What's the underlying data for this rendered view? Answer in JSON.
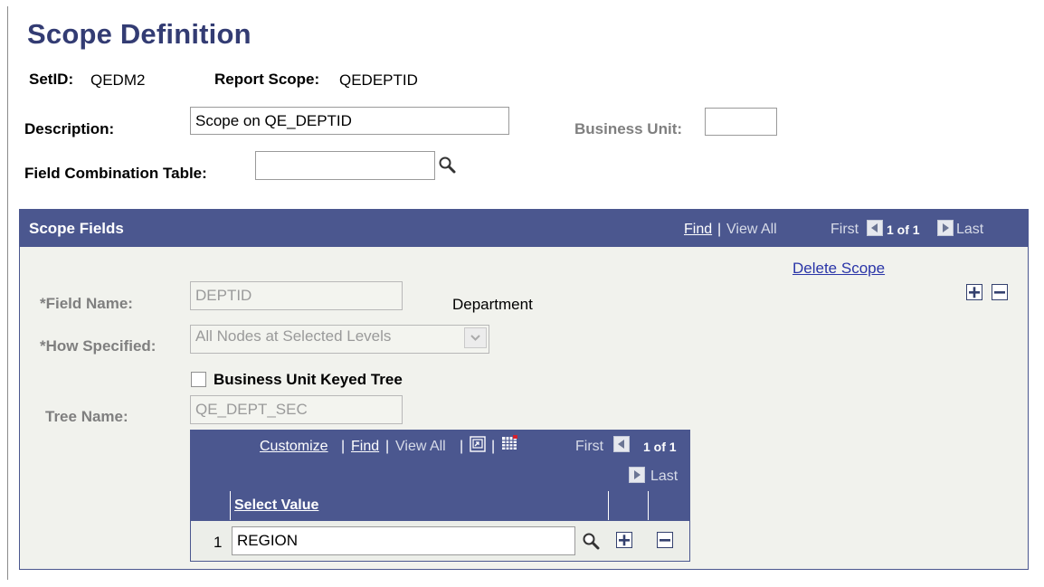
{
  "page": {
    "title": "Scope Definition",
    "setid_label": "SetID:",
    "setid_value": "QEDM2",
    "report_scope_label": "Report Scope:",
    "report_scope_value": "QEDEPTID",
    "description_label": "Description:",
    "description_value": "Scope on QE_DEPTID",
    "business_unit_label": "Business Unit:",
    "business_unit_value": "",
    "field_combo_label": "Field Combination Table:",
    "field_combo_value": ""
  },
  "scope_fields": {
    "title": "Scope Fields",
    "nav": {
      "find": "Find",
      "sep": "|",
      "view_all": "View All",
      "first": "First",
      "count": "1 of 1",
      "last": "Last"
    },
    "delete_scope": "Delete Scope",
    "field_name_label": "*Field Name:",
    "field_name_value": "DEPTID",
    "field_description": "Department",
    "how_specified_label": "*How Specified:",
    "how_specified_value": "All Nodes at Selected Levels",
    "bu_keyed_tree_label": "Business Unit Keyed Tree",
    "bu_keyed_tree_checked": false,
    "tree_name_label": "Tree Name:",
    "tree_name_value": "QE_DEPT_SEC"
  },
  "values_grid": {
    "nav": {
      "customize": "Customize",
      "sep": "|",
      "find": "Find",
      "view_all": "View All",
      "first": "First",
      "count": "1 of 1",
      "last": "Last"
    },
    "column_header": "Select Value",
    "rows": [
      {
        "num": "1",
        "value": "REGION"
      }
    ]
  },
  "icons": {
    "lookup": "magnifier-icon",
    "add": "plus-icon",
    "delete": "minus-icon",
    "zoom": "new-window-icon",
    "download": "spreadsheet-icon",
    "prev": "left-arrow-icon",
    "next": "right-arrow-icon"
  },
  "colors": {
    "title": "#333c73",
    "header_bg": "#4b578f",
    "panel_bg": "#f1f2ed",
    "link": "#2a35a8"
  }
}
